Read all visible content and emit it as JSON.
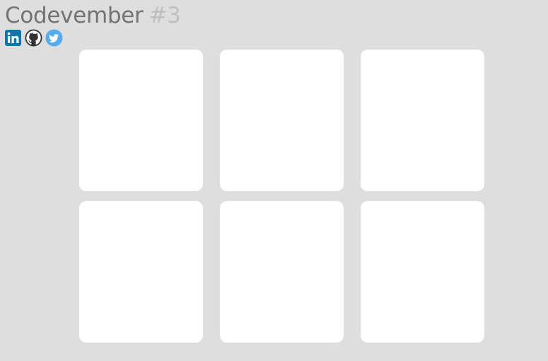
{
  "header": {
    "title": "Codevember",
    "number": "#3"
  },
  "social_links": [
    {
      "name": "linkedin",
      "icon": "linkedin-icon",
      "color": "#0e76a8"
    },
    {
      "name": "github",
      "icon": "github-icon",
      "color": "#333333"
    },
    {
      "name": "twitter",
      "icon": "twitter-icon",
      "color": "#55acee"
    }
  ],
  "cards": [
    {
      "id": 1
    },
    {
      "id": 2
    },
    {
      "id": 3
    },
    {
      "id": 4
    },
    {
      "id": 5
    },
    {
      "id": 6
    }
  ],
  "colors": {
    "background": "#dedede",
    "card": "#ffffff",
    "title": "#737373",
    "title_number": "#bfbfbf"
  }
}
